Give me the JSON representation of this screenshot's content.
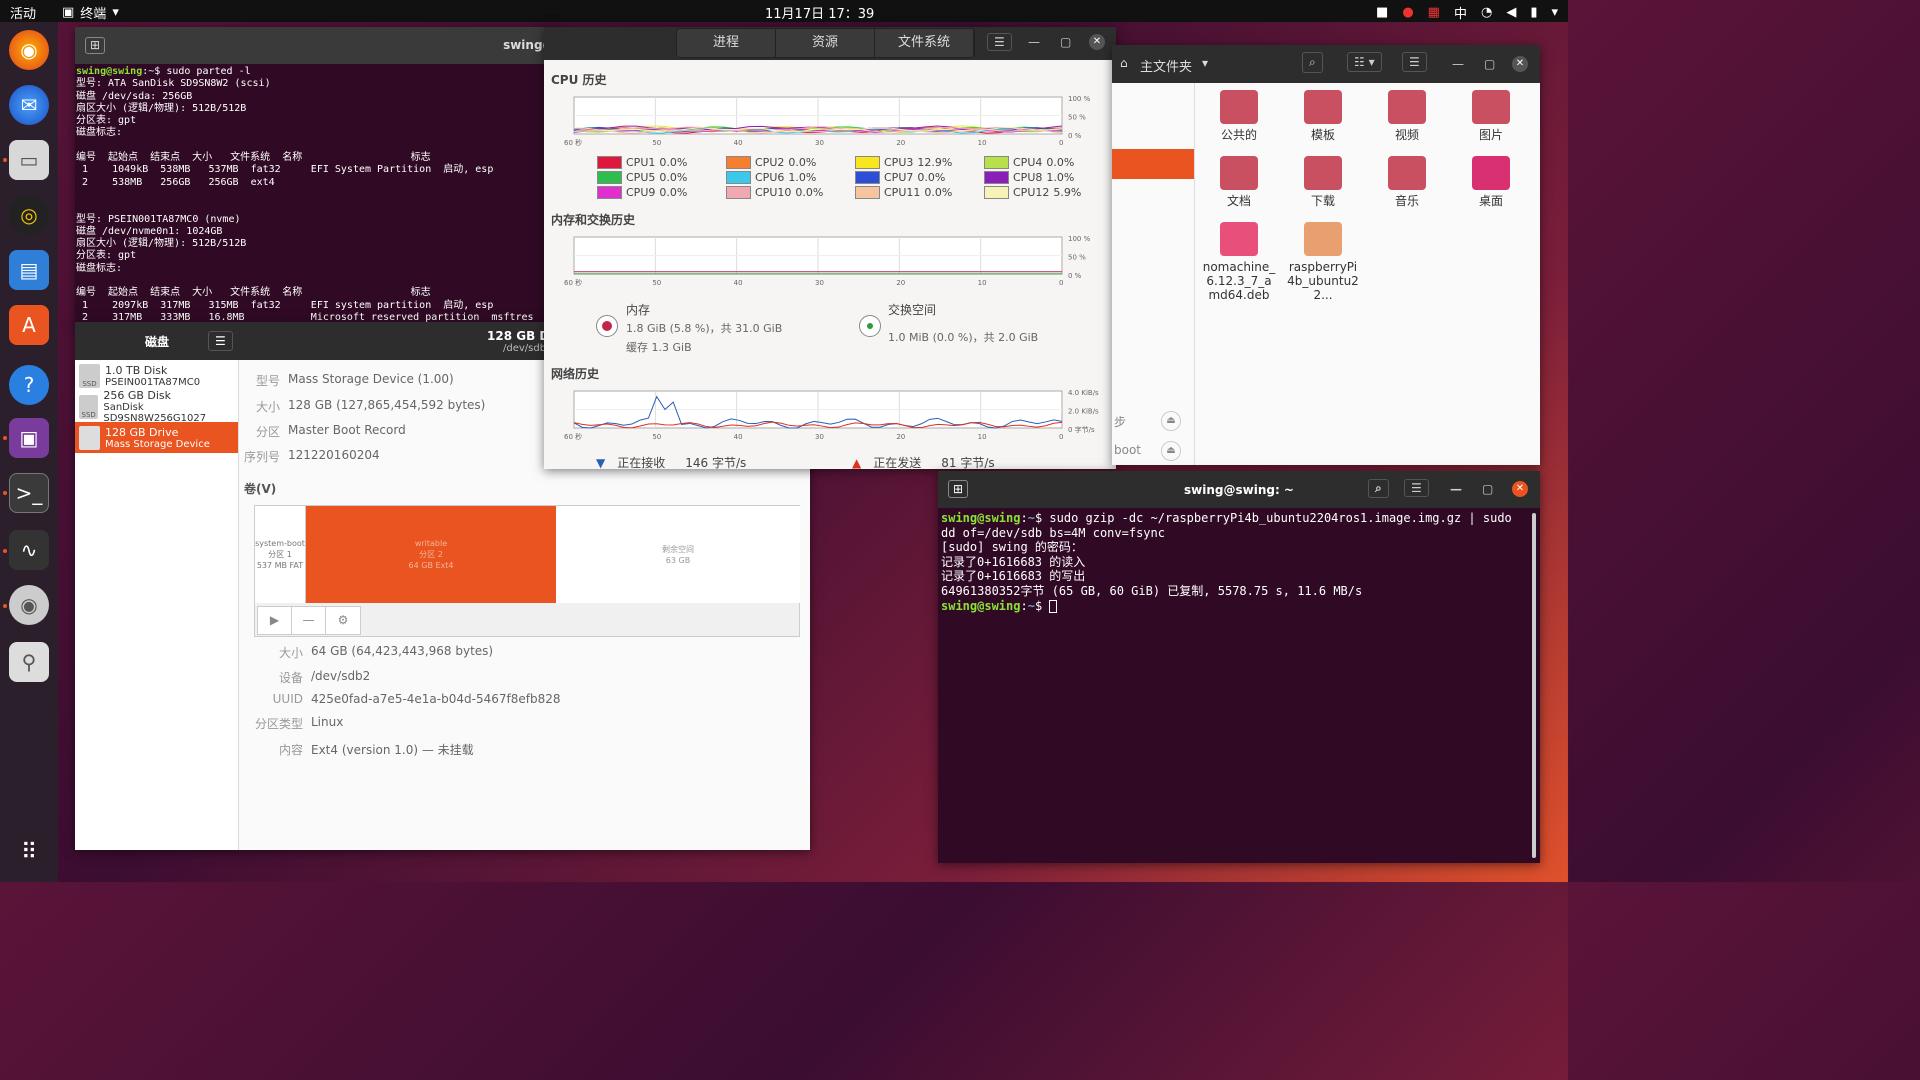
{
  "topbar": {
    "activities": "活动",
    "app": "终端",
    "clock": "11月17日  17：39",
    "ime": "中"
  },
  "term1": {
    "title": "swing@",
    "lines": [
      {
        "p": "swing@swing",
        "c": ":~$ sudo parted -l"
      },
      {
        "t": "型号: ATA SanDisk SD9SN8W2 (scsi)"
      },
      {
        "t": "磁盘 /dev/sda: 256GB"
      },
      {
        "t": "扇区大小 (逻辑/物理): 512B/512B"
      },
      {
        "t": "分区表: gpt"
      },
      {
        "t": "磁盘标志:"
      },
      {
        "t": ""
      },
      {
        "t": "编号  起始点  结束点  大小   文件系统  名称                  标志"
      },
      {
        "t": " 1    1049kB  538MB   537MB  fat32     EFI System Partition  启动, esp"
      },
      {
        "t": " 2    538MB   256GB   256GB  ext4"
      },
      {
        "t": ""
      },
      {
        "t": ""
      },
      {
        "t": "型号: PSEIN001TA87MC0 (nvme)"
      },
      {
        "t": "磁盘 /dev/nvme0n1: 1024GB"
      },
      {
        "t": "扇区大小 (逻辑/物理): 512B/512B"
      },
      {
        "t": "分区表: gpt"
      },
      {
        "t": "磁盘标志:"
      },
      {
        "t": ""
      },
      {
        "t": "编号  起始点  结束点  大小   文件系统  名称                  标志"
      },
      {
        "t": " 1    2097kB  317MB   315MB  fat32     EFI system partition  启动, esp"
      },
      {
        "t": " 2    317MB   333MB   16.8MB           Microsoft reserved partition  msftres"
      }
    ]
  },
  "disks": {
    "title": "磁盘",
    "drive_title": "128 GB Dr",
    "drive_sub": "/dev/sdb",
    "list": [
      {
        "name": "1.0 TB Disk",
        "sub": "PSEIN001TA87MC0",
        "badge": "SSD"
      },
      {
        "name": "256 GB Disk",
        "sub": "SanDisk SD9SN8W256G1027",
        "badge": "SSD"
      },
      {
        "name": "128 GB Drive",
        "sub": "Mass Storage Device",
        "badge": ""
      }
    ],
    "info": [
      {
        "k": "型号",
        "v": "Mass Storage Device (1.00)"
      },
      {
        "k": "大小",
        "v": "128 GB (127,865,454,592 bytes)"
      },
      {
        "k": "分区",
        "v": "Master Boot Record"
      },
      {
        "k": "序列号",
        "v": "121220160204"
      }
    ],
    "volumes_label": "卷(V)",
    "parts": [
      {
        "a": "system-boot",
        "b": "分区 1",
        "c": "537 MB FAT"
      },
      {
        "a": "writable",
        "b": "分区 2",
        "c": "64 GB Ext4"
      },
      {
        "a": "剩余空间",
        "b": "63 GB",
        "c": ""
      }
    ],
    "details": [
      {
        "k": "大小",
        "v": "64 GB (64,423,443,968 bytes)"
      },
      {
        "k": "设备",
        "v": "/dev/sdb2"
      },
      {
        "k": "UUID",
        "v": "425e0fad-a7e5-4e1a-b04d-5467f8efb828"
      },
      {
        "k": "分区类型",
        "v": "Linux"
      },
      {
        "k": "内容",
        "v": "Ext4 (version 1.0) — 未挂载"
      }
    ]
  },
  "monitor": {
    "tabs": [
      "进程",
      "资源",
      "文件系统"
    ],
    "cpu_title": "CPU 历史",
    "mem_title": "内存和交换历史",
    "net_title": "网络历史",
    "pct_ticks": [
      "100 %",
      "50 %",
      "0 %"
    ],
    "time_ticks": [
      "60 秒",
      "50",
      "40",
      "30",
      "20",
      "10",
      "0"
    ],
    "net_ticks": [
      "4.0 KiB/s",
      "2.0 KiB/s",
      "0 字节/s"
    ],
    "cpus": [
      {
        "n": "CPU1",
        "v": "0.0%",
        "c": "#e0173d"
      },
      {
        "n": "CPU2",
        "v": "0.0%",
        "c": "#f57e2f"
      },
      {
        "n": "CPU3",
        "v": "12.9%",
        "c": "#f8e71c"
      },
      {
        "n": "CPU4",
        "v": "0.0%",
        "c": "#b8e04a"
      },
      {
        "n": "CPU5",
        "v": "0.0%",
        "c": "#2ebd4e"
      },
      {
        "n": "CPU6",
        "v": "1.0%",
        "c": "#3cc8e8"
      },
      {
        "n": "CPU7",
        "v": "0.0%",
        "c": "#2d4fd8"
      },
      {
        "n": "CPU8",
        "v": "1.0%",
        "c": "#8a1fb8"
      },
      {
        "n": "CPU9",
        "v": "0.0%",
        "c": "#e12fcf"
      },
      {
        "n": "CPU10",
        "v": "0.0%",
        "c": "#f2a8b0"
      },
      {
        "n": "CPU11",
        "v": "0.0%",
        "c": "#f7c4a0"
      },
      {
        "n": "CPU12",
        "v": "5.9%",
        "c": "#f7f2b8"
      }
    ],
    "mem": {
      "label": "内存",
      "line1": "1.8 GiB (5.8 %)，共 31.0 GiB",
      "line2": "缓存 1.3 GiB"
    },
    "swap": {
      "label": "交换空间",
      "line1": "1.0 MiB (0.0 %)，共 2.0 GiB"
    },
    "recv": {
      "label": "正在接收",
      "v": "146 字节/s"
    },
    "send": {
      "label": "正在发送",
      "v": "81 字节/s"
    }
  },
  "files": {
    "title": "主文件夹",
    "items": [
      {
        "n": "公共的",
        "c": "#c85060"
      },
      {
        "n": "模板",
        "c": "#c85060"
      },
      {
        "n": "视频",
        "c": "#c85060"
      },
      {
        "n": "图片",
        "c": "#c85060"
      },
      {
        "n": "文档",
        "c": "#c85060"
      },
      {
        "n": "下载",
        "c": "#c85060"
      },
      {
        "n": "音乐",
        "c": "#c85060"
      },
      {
        "n": "桌面",
        "c": "#d83070"
      },
      {
        "n": "nomachine_6.12.3_7_amd64.deb",
        "c": "#e84f7a"
      },
      {
        "n": "raspberryPi4b_ubuntu22...",
        "c": "#e8a070"
      }
    ],
    "side_a": "步",
    "side_b": "boot"
  },
  "term2": {
    "title": "swing@swing: ~",
    "prompt": "swing@swing",
    "path": "~",
    "cmd": "$ sudo gzip -dc ~/raspberryPi4b_ubuntu2204ros1.image.img.gz | sudo",
    "cont": "dd of=/dev/sdb bs=4M conv=fsync",
    "out": [
      "[sudo] swing 的密码：",
      "记录了0+1616683 的读入",
      "记录了0+1616683 的写出",
      "64961380352字节 (65 GB, 60 GiB) 已复制, 5578.75 s, 11.6 MB/s"
    ],
    "end": "$ "
  }
}
